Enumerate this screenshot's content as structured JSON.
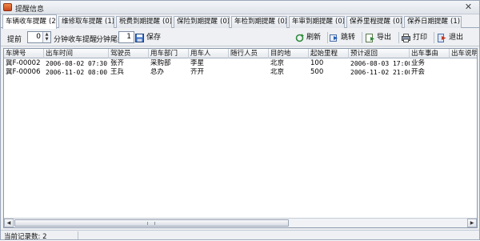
{
  "window": {
    "title": "提醒信息",
    "close_glyph": "✕"
  },
  "tabs": [
    {
      "label": "车辆收车提醒",
      "count": "(2)"
    },
    {
      "label": "维修取车提醒",
      "count": "(1)"
    },
    {
      "label": "税费到期提醒",
      "count": "(0)"
    },
    {
      "label": "保险到期提醒",
      "count": "(0)"
    },
    {
      "label": "年检到期提醒",
      "count": "(0)"
    },
    {
      "label": "年审到期提醒",
      "count": "(0)"
    },
    {
      "label": "保养里程提醒",
      "count": "(0)"
    },
    {
      "label": "保养日期提醒",
      "count": "(1)"
    }
  ],
  "toolbar": {
    "advance_label": "提前",
    "advance_value": "0",
    "minutes_label": "分钟收车提醒",
    "tail_label": "分钟尾数",
    "tail_value": "1",
    "save_label": "保存",
    "refresh_label": "刷新",
    "jump_label": "跳转",
    "export_label": "导出",
    "print_label": "打印",
    "exit_label": "退出"
  },
  "table": {
    "columns": [
      "车牌号",
      "出车时间",
      "驾驶员",
      "用车部门",
      "用车人",
      "随行人员",
      "目的地",
      "起始里程",
      "预计返回",
      "出车事由",
      "出车说明"
    ],
    "rows": [
      [
        "冀F-00002",
        "2006-08-02 07:30:00",
        "张齐",
        "采购部",
        "李星",
        "",
        "北京",
        "100",
        "2006-08-03 17:00:00",
        "业务",
        ""
      ],
      [
        "冀F-00006",
        "2006-11-02 08:00:00",
        "王兵",
        "总办",
        "齐开",
        "",
        "北京",
        "500",
        "2006-11-02 21:00:00",
        "开会",
        ""
      ]
    ]
  },
  "status": {
    "text": "当前记录数: 2"
  },
  "colors": {
    "accent": "#1f5fb5",
    "header_bg": "#e6e9ee",
    "border": "#8c99ab"
  }
}
